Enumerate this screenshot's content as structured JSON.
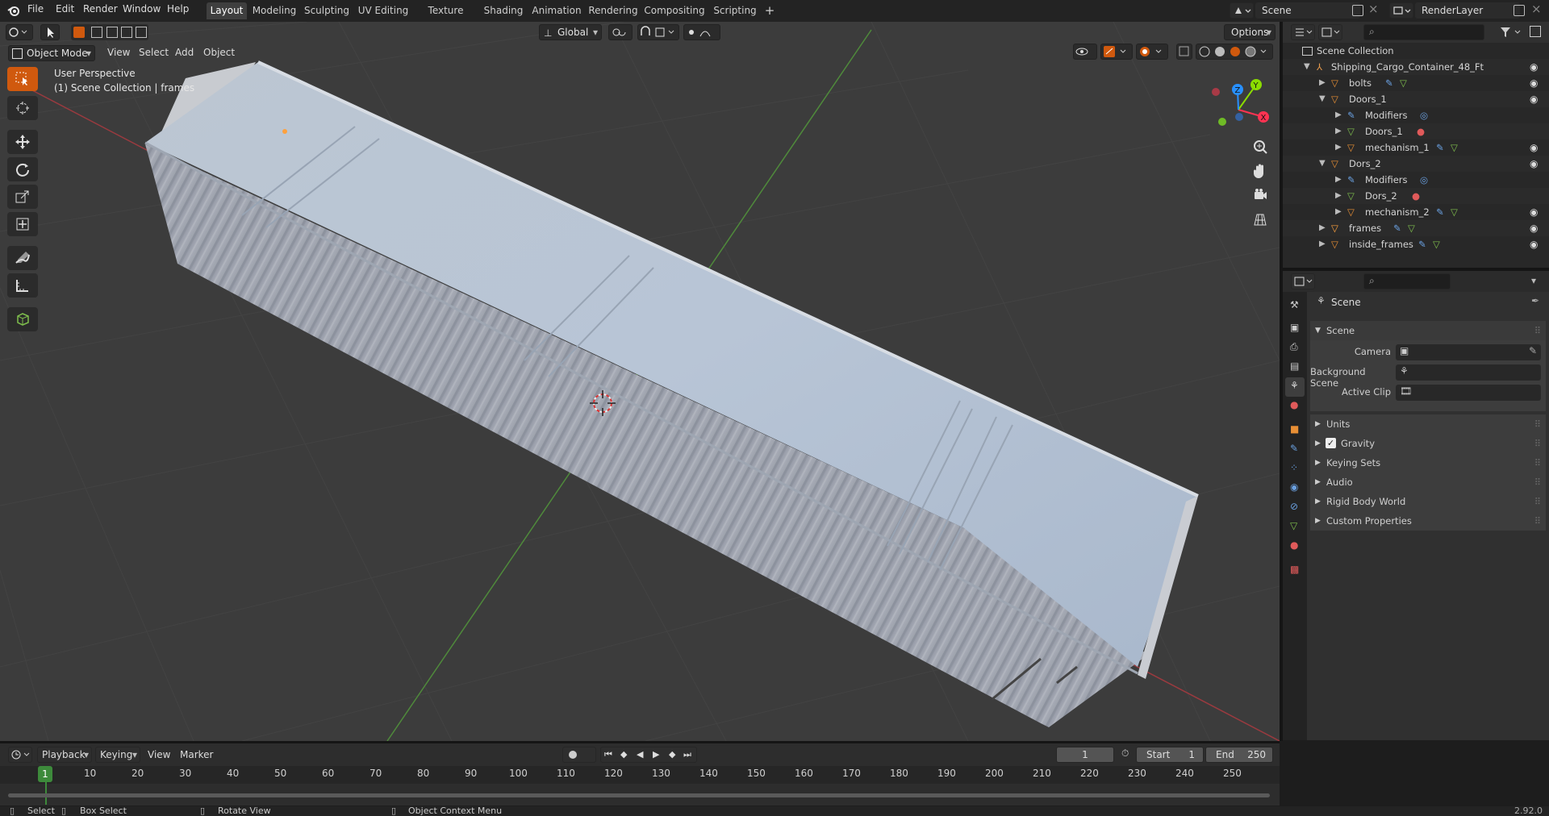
{
  "menu": [
    "File",
    "Edit",
    "Render",
    "Window",
    "Help"
  ],
  "workspaces": [
    "Layout",
    "Modeling",
    "Sculpting",
    "UV Editing",
    "Texture Paint",
    "Shading",
    "Animation",
    "Rendering",
    "Compositing",
    "Scripting"
  ],
  "active_workspace": "Layout",
  "scene_name": "Scene",
  "view_layer": "RenderLayer",
  "viewport": {
    "mode": "Object Mode",
    "menus": [
      "View",
      "Select",
      "Add",
      "Object"
    ],
    "orientation": "Global",
    "options": "Options",
    "overlay_title": "User Perspective",
    "overlay_subtitle": "(1) Scene Collection | frames",
    "gizmo_axes": {
      "x": "X",
      "y": "Y",
      "z": "Z"
    }
  },
  "outliner": {
    "rows": [
      {
        "label": "Scene Collection"
      },
      {
        "label": "Shipping_Cargo_Container_48_Ft"
      },
      {
        "label": "bolts"
      },
      {
        "label": "Doors_1"
      },
      {
        "label": "Modifiers"
      },
      {
        "label": "Doors_1"
      },
      {
        "label": "mechanism_1"
      },
      {
        "label": "Dors_2"
      },
      {
        "label": "Modifiers"
      },
      {
        "label": "Dors_2"
      },
      {
        "label": "mechanism_2"
      },
      {
        "label": "frames"
      },
      {
        "label": "inside_frames"
      }
    ]
  },
  "properties": {
    "context": "Scene",
    "panel_title": "Scene",
    "fields": {
      "camera": "Camera",
      "background_scene": "Background Scene",
      "active_clip": "Active Clip"
    },
    "subpanels": [
      "Units",
      "Gravity",
      "Keying Sets",
      "Audio",
      "Rigid Body World",
      "Custom Properties"
    ],
    "gravity_checked": true
  },
  "timeline": {
    "menus": [
      "Playback",
      "Keying",
      "View",
      "Marker"
    ],
    "current_frame": "1",
    "start_label": "Start",
    "start": "1",
    "end_label": "End",
    "end": "250",
    "ruler": [
      "10",
      "20",
      "30",
      "40",
      "50",
      "60",
      "70",
      "80",
      "90",
      "100",
      "110",
      "120",
      "130",
      "140",
      "150",
      "160",
      "170",
      "180",
      "190",
      "200",
      "210",
      "220",
      "230",
      "240",
      "250"
    ],
    "playhead": "1"
  },
  "statusbar": {
    "items": [
      "Select",
      "Box Select",
      "Rotate View",
      "Object Context Menu"
    ],
    "version": "2.92.0"
  },
  "colors": {
    "accent": "#d0590e",
    "selection_active": "#ffa13d",
    "x_axis": "#ff3352",
    "y_axis": "#8bdc00",
    "z_axis": "#2890ff"
  }
}
